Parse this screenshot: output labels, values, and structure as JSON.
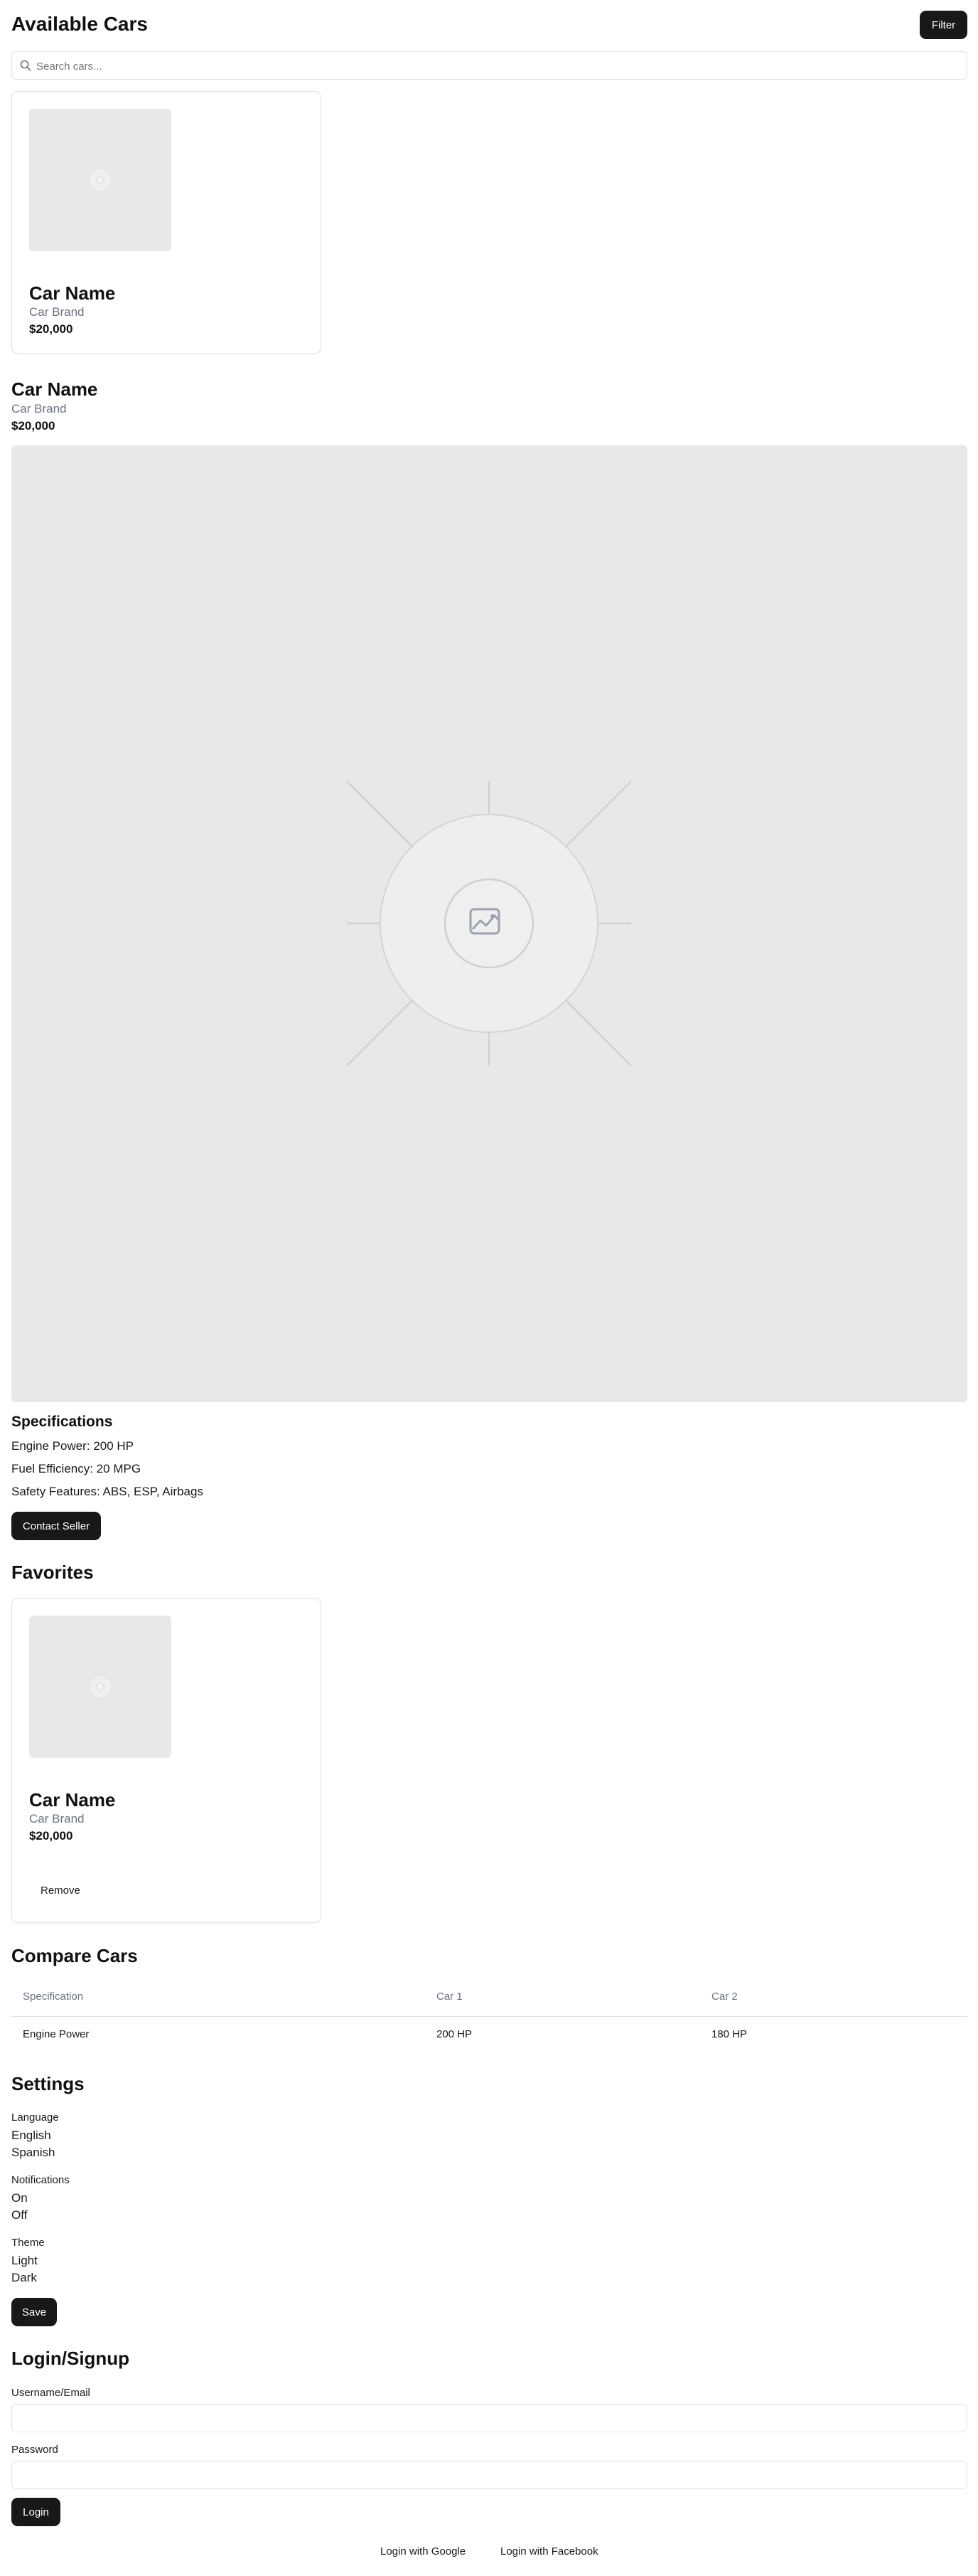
{
  "header": {
    "title": "Available Cars",
    "filter_label": "Filter"
  },
  "search": {
    "placeholder": "Search cars..."
  },
  "listing_card": {
    "name": "Car Name",
    "brand": "Car Brand",
    "price": "$20,000"
  },
  "detail": {
    "name": "Car Name",
    "brand": "Car Brand",
    "price": "$20,000",
    "specs_title": "Specifications",
    "specs": [
      "Engine Power: 200 HP",
      "Fuel Efficiency: 20 MPG",
      "Safety Features: ABS, ESP, Airbags"
    ],
    "contact_label": "Contact Seller"
  },
  "favorites": {
    "title": "Favorites",
    "card": {
      "name": "Car Name",
      "brand": "Car Brand",
      "price": "$20,000",
      "remove_label": "Remove"
    }
  },
  "compare": {
    "title": "Compare Cars",
    "headers": [
      "Specification",
      "Car 1",
      "Car 2"
    ],
    "rows": [
      [
        "Engine Power",
        "200 HP",
        "180 HP"
      ]
    ]
  },
  "settings": {
    "title": "Settings",
    "groups": [
      {
        "label": "Language",
        "options": [
          "English",
          "Spanish"
        ]
      },
      {
        "label": "Notifications",
        "options": [
          "On",
          "Off"
        ]
      },
      {
        "label": "Theme",
        "options": [
          "Light",
          "Dark"
        ]
      }
    ],
    "save_label": "Save"
  },
  "auth": {
    "title": "Login/Signup",
    "username_label": "Username/Email",
    "password_label": "Password",
    "login_label": "Login",
    "google_label": "Login with Google",
    "facebook_label": "Login with Facebook"
  },
  "colors": {
    "primary_button": "#18181b",
    "placeholder_bg": "#e8e8e8",
    "muted_text": "#6b7280",
    "border": "#e2e2e2"
  },
  "icons": {
    "search": "search-icon",
    "image_placeholder": "image-placeholder-icon"
  }
}
